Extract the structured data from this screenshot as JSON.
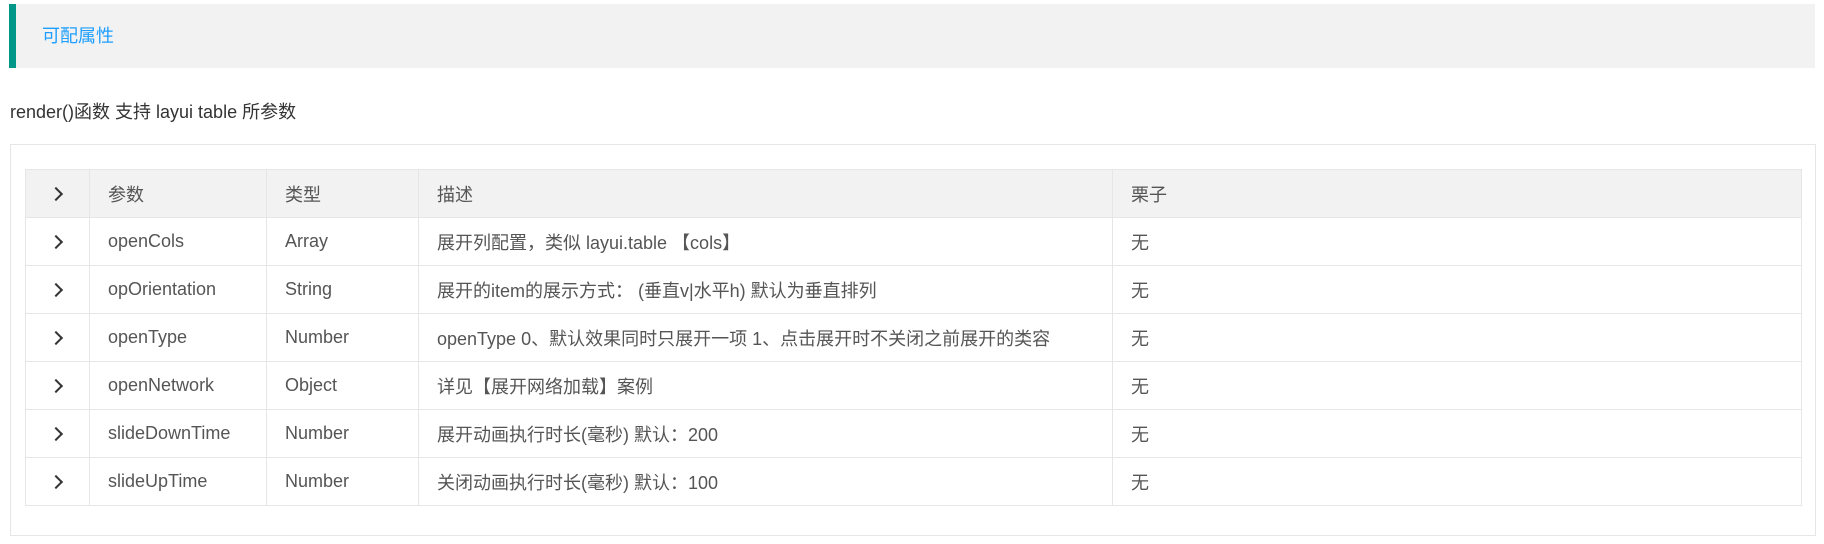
{
  "section": {
    "title": "可配属性"
  },
  "intro": "render()函数 支持 layui table 所参数",
  "table": {
    "headers": {
      "expand": "",
      "param": "参数",
      "type": "类型",
      "desc": "描述",
      "example": "栗子"
    },
    "rows": [
      {
        "param": "openCols",
        "type": "Array",
        "desc": "展开列配置，类似 layui.table 【cols】",
        "example": "无"
      },
      {
        "param": "opOrientation",
        "type": "String",
        "desc": "展开的item的展示方式：  (垂直v|水平h) 默认为垂直排列",
        "example": "无"
      },
      {
        "param": "openType",
        "type": "Number",
        "desc": "openType 0、默认效果同时只展开一项 1、点击展开时不关闭之前展开的类容",
        "example": "无"
      },
      {
        "param": "openNetwork",
        "type": "Object",
        "desc": "详见【展开网络加载】案例",
        "example": "无"
      },
      {
        "param": "slideDownTime",
        "type": "Number",
        "desc": "展开动画执行时长(毫秒) 默认：200",
        "example": "无"
      },
      {
        "param": "slideUpTime",
        "type": "Number",
        "desc": "关闭动画执行时长(毫秒) 默认：100",
        "example": "无"
      }
    ]
  },
  "icons": {
    "expand": "chevron-right-icon"
  },
  "colors": {
    "accent_bar": "#009688",
    "title_link": "#1e9fff",
    "header_bg": "#f2f2f2",
    "border": "#e6e6e6"
  }
}
